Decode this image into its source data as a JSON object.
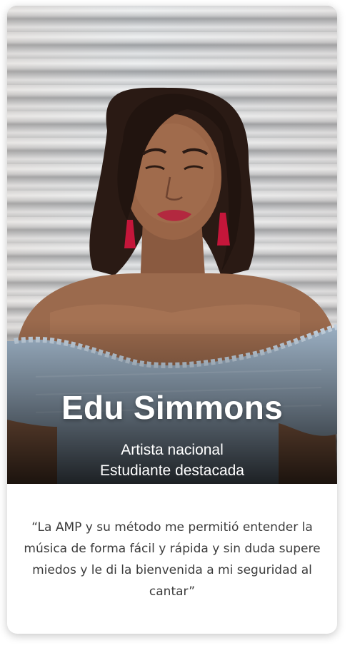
{
  "profile": {
    "name": "Edu Simmons",
    "role_line1": "Artista nacional",
    "role_line2": "Estudiante destacada",
    "photo_icon": "portrait-photo"
  },
  "testimonial": {
    "quote": "“La AMP y su método me permitió entender la música de forma fácil y rápida y sin duda supere miedos y le di la bienvenida a mi seguridad al cantar”"
  },
  "colors": {
    "card_background": "#ffffff",
    "name_text": "#ffffff",
    "quote_text": "#3b3b3b",
    "earring_red": "#c4163a",
    "top_blue": "#9fb4c8"
  }
}
